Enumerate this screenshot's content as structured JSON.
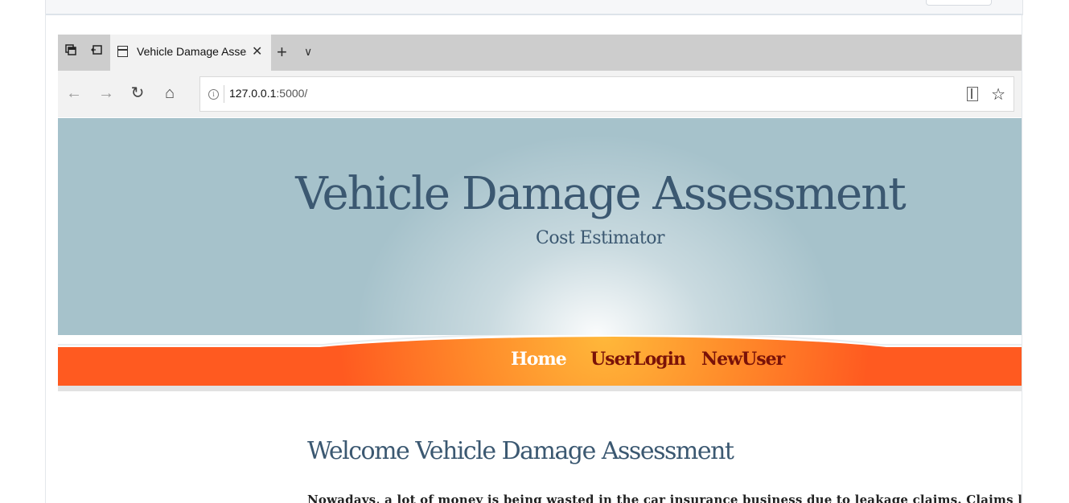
{
  "browser": {
    "tab_title": "Vehicle Damage Assessi",
    "tab_close": "✕",
    "new_tab": "+",
    "tab_list": "∨",
    "url_host": "127.0.0.1",
    "url_path": ":5000/",
    "info_glyph": "i",
    "back_glyph": "←",
    "forward_glyph": "→",
    "refresh_glyph": "↻",
    "home_glyph": "⌂",
    "favorite_glyph": "☆"
  },
  "site": {
    "title": "Vehicle Damage Assessment",
    "subtitle": "Cost Estimator",
    "nav": [
      {
        "label": "Home",
        "color": "#ffffff",
        "active": true
      },
      {
        "label": "UserLogin",
        "color": "#7a1208",
        "active": false
      },
      {
        "label": "NewUser",
        "color": "#7a1208",
        "active": false
      }
    ]
  },
  "content": {
    "heading": "Welcome Vehicle Damage Assessment",
    "intro": "Nowadays, a lot of money is being wasted in the car insurance business due to leakage claims. Claims leakage"
  },
  "colors": {
    "header_bg": "#a6c2cb",
    "nav_orange": "#ff5a20",
    "nav_highlight": "#ffb52e",
    "title_color": "#3b5871"
  }
}
